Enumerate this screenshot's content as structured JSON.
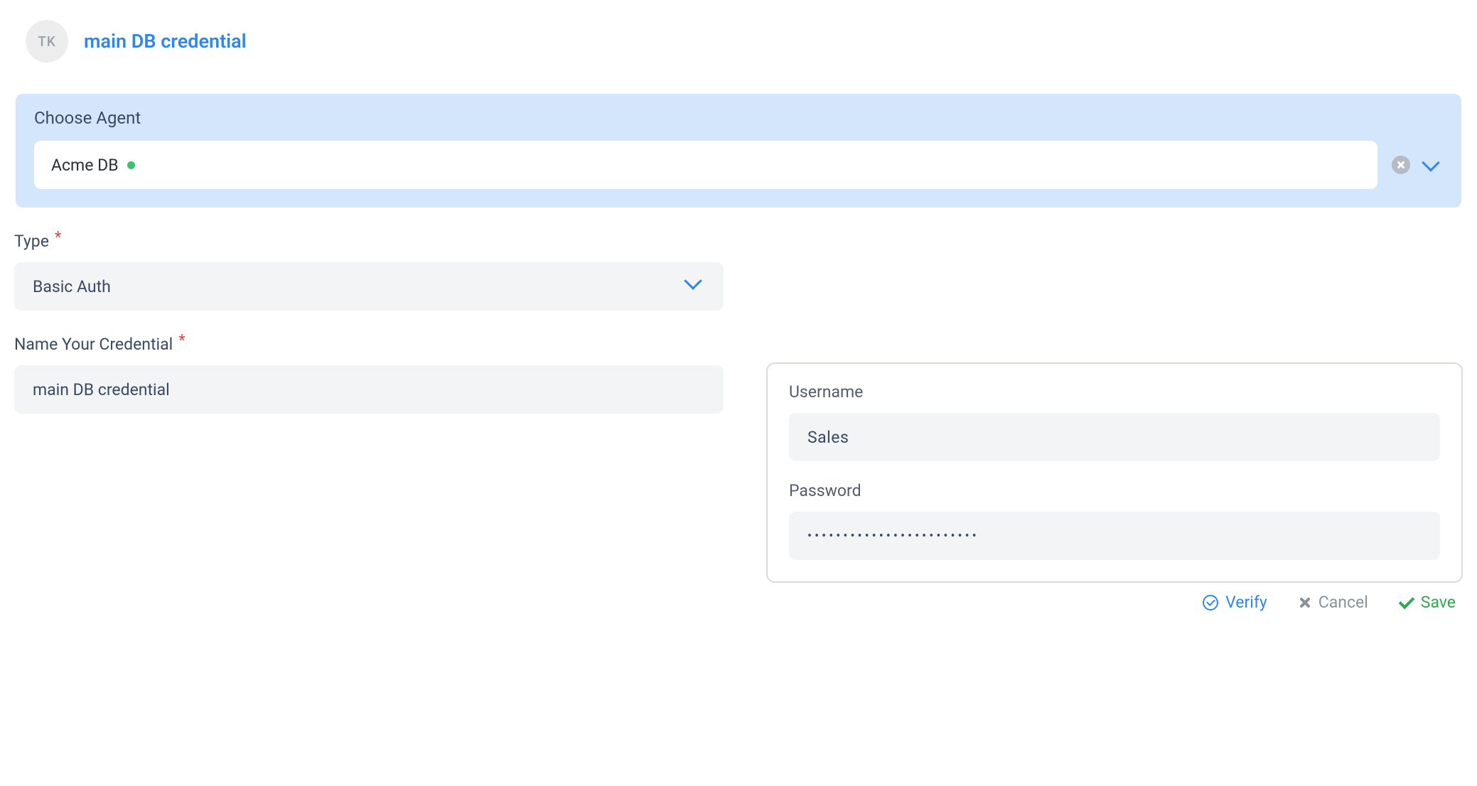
{
  "header": {
    "avatar_initials": "TK",
    "title": "main DB credential"
  },
  "agent_panel": {
    "label": "Choose Agent",
    "selected": "Acme DB",
    "status": "online"
  },
  "type_field": {
    "label": "Type",
    "value": "Basic Auth"
  },
  "name_field": {
    "label": "Name Your Credential",
    "value": "main DB credential"
  },
  "credentials": {
    "username_label": "Username",
    "username_value": "Sales",
    "password_label": "Password",
    "password_value": "••••••••••••••••••••••••"
  },
  "actions": {
    "verify": "Verify",
    "cancel": "Cancel",
    "save": "Save"
  }
}
